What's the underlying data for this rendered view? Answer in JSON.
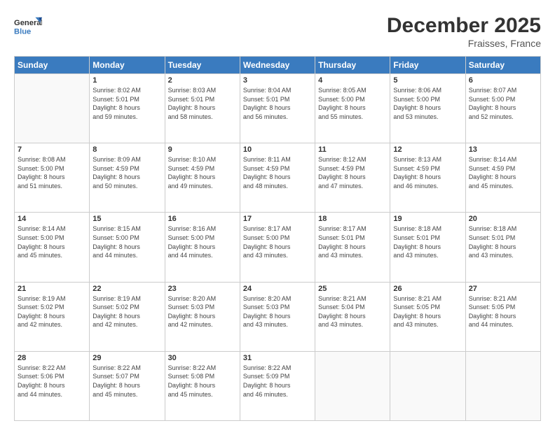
{
  "header": {
    "logo": {
      "line1": "General",
      "line2": "Blue"
    },
    "title": "December 2025",
    "location": "Fraisses, France"
  },
  "calendar": {
    "days_of_week": [
      "Sunday",
      "Monday",
      "Tuesday",
      "Wednesday",
      "Thursday",
      "Friday",
      "Saturday"
    ],
    "weeks": [
      [
        {
          "day": "",
          "info": ""
        },
        {
          "day": "1",
          "info": "Sunrise: 8:02 AM\nSunset: 5:01 PM\nDaylight: 8 hours\nand 59 minutes."
        },
        {
          "day": "2",
          "info": "Sunrise: 8:03 AM\nSunset: 5:01 PM\nDaylight: 8 hours\nand 58 minutes."
        },
        {
          "day": "3",
          "info": "Sunrise: 8:04 AM\nSunset: 5:01 PM\nDaylight: 8 hours\nand 56 minutes."
        },
        {
          "day": "4",
          "info": "Sunrise: 8:05 AM\nSunset: 5:00 PM\nDaylight: 8 hours\nand 55 minutes."
        },
        {
          "day": "5",
          "info": "Sunrise: 8:06 AM\nSunset: 5:00 PM\nDaylight: 8 hours\nand 53 minutes."
        },
        {
          "day": "6",
          "info": "Sunrise: 8:07 AM\nSunset: 5:00 PM\nDaylight: 8 hours\nand 52 minutes."
        }
      ],
      [
        {
          "day": "7",
          "info": "Sunrise: 8:08 AM\nSunset: 5:00 PM\nDaylight: 8 hours\nand 51 minutes."
        },
        {
          "day": "8",
          "info": "Sunrise: 8:09 AM\nSunset: 4:59 PM\nDaylight: 8 hours\nand 50 minutes."
        },
        {
          "day": "9",
          "info": "Sunrise: 8:10 AM\nSunset: 4:59 PM\nDaylight: 8 hours\nand 49 minutes."
        },
        {
          "day": "10",
          "info": "Sunrise: 8:11 AM\nSunset: 4:59 PM\nDaylight: 8 hours\nand 48 minutes."
        },
        {
          "day": "11",
          "info": "Sunrise: 8:12 AM\nSunset: 4:59 PM\nDaylight: 8 hours\nand 47 minutes."
        },
        {
          "day": "12",
          "info": "Sunrise: 8:13 AM\nSunset: 4:59 PM\nDaylight: 8 hours\nand 46 minutes."
        },
        {
          "day": "13",
          "info": "Sunrise: 8:14 AM\nSunset: 4:59 PM\nDaylight: 8 hours\nand 45 minutes."
        }
      ],
      [
        {
          "day": "14",
          "info": "Sunrise: 8:14 AM\nSunset: 5:00 PM\nDaylight: 8 hours\nand 45 minutes."
        },
        {
          "day": "15",
          "info": "Sunrise: 8:15 AM\nSunset: 5:00 PM\nDaylight: 8 hours\nand 44 minutes."
        },
        {
          "day": "16",
          "info": "Sunrise: 8:16 AM\nSunset: 5:00 PM\nDaylight: 8 hours\nand 44 minutes."
        },
        {
          "day": "17",
          "info": "Sunrise: 8:17 AM\nSunset: 5:00 PM\nDaylight: 8 hours\nand 43 minutes."
        },
        {
          "day": "18",
          "info": "Sunrise: 8:17 AM\nSunset: 5:01 PM\nDaylight: 8 hours\nand 43 minutes."
        },
        {
          "day": "19",
          "info": "Sunrise: 8:18 AM\nSunset: 5:01 PM\nDaylight: 8 hours\nand 43 minutes."
        },
        {
          "day": "20",
          "info": "Sunrise: 8:18 AM\nSunset: 5:01 PM\nDaylight: 8 hours\nand 43 minutes."
        }
      ],
      [
        {
          "day": "21",
          "info": "Sunrise: 8:19 AM\nSunset: 5:02 PM\nDaylight: 8 hours\nand 42 minutes."
        },
        {
          "day": "22",
          "info": "Sunrise: 8:19 AM\nSunset: 5:02 PM\nDaylight: 8 hours\nand 42 minutes."
        },
        {
          "day": "23",
          "info": "Sunrise: 8:20 AM\nSunset: 5:03 PM\nDaylight: 8 hours\nand 42 minutes."
        },
        {
          "day": "24",
          "info": "Sunrise: 8:20 AM\nSunset: 5:03 PM\nDaylight: 8 hours\nand 43 minutes."
        },
        {
          "day": "25",
          "info": "Sunrise: 8:21 AM\nSunset: 5:04 PM\nDaylight: 8 hours\nand 43 minutes."
        },
        {
          "day": "26",
          "info": "Sunrise: 8:21 AM\nSunset: 5:05 PM\nDaylight: 8 hours\nand 43 minutes."
        },
        {
          "day": "27",
          "info": "Sunrise: 8:21 AM\nSunset: 5:05 PM\nDaylight: 8 hours\nand 44 minutes."
        }
      ],
      [
        {
          "day": "28",
          "info": "Sunrise: 8:22 AM\nSunset: 5:06 PM\nDaylight: 8 hours\nand 44 minutes."
        },
        {
          "day": "29",
          "info": "Sunrise: 8:22 AM\nSunset: 5:07 PM\nDaylight: 8 hours\nand 45 minutes."
        },
        {
          "day": "30",
          "info": "Sunrise: 8:22 AM\nSunset: 5:08 PM\nDaylight: 8 hours\nand 45 minutes."
        },
        {
          "day": "31",
          "info": "Sunrise: 8:22 AM\nSunset: 5:09 PM\nDaylight: 8 hours\nand 46 minutes."
        },
        {
          "day": "",
          "info": ""
        },
        {
          "day": "",
          "info": ""
        },
        {
          "day": "",
          "info": ""
        }
      ]
    ]
  }
}
